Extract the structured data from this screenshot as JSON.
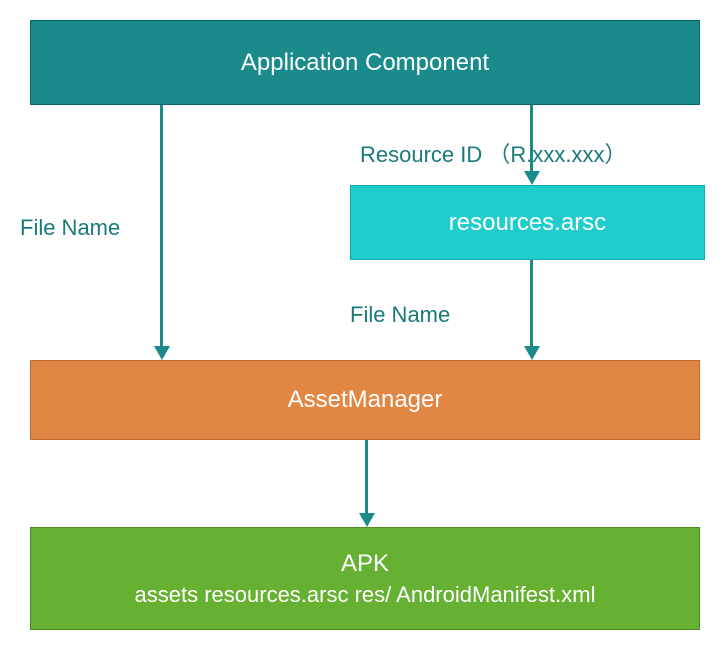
{
  "boxes": {
    "application_component": "Application Component",
    "resources_arsc": "resources.arsc",
    "asset_manager": "AssetManager",
    "apk_title": "APK",
    "apk_subtitle": "assets resources.arsc res/ AndroidManifest.xml"
  },
  "labels": {
    "resource_id": "Resource ID （R.xxx.xxx）",
    "file_name_left": "File Name",
    "file_name_middle": "File Name"
  },
  "colors": {
    "teal_dark": "#1a8a8a",
    "teal_light": "#1fcdcd",
    "orange": "#e28743",
    "green": "#66b032",
    "text_teal": "#1a7a7a"
  }
}
